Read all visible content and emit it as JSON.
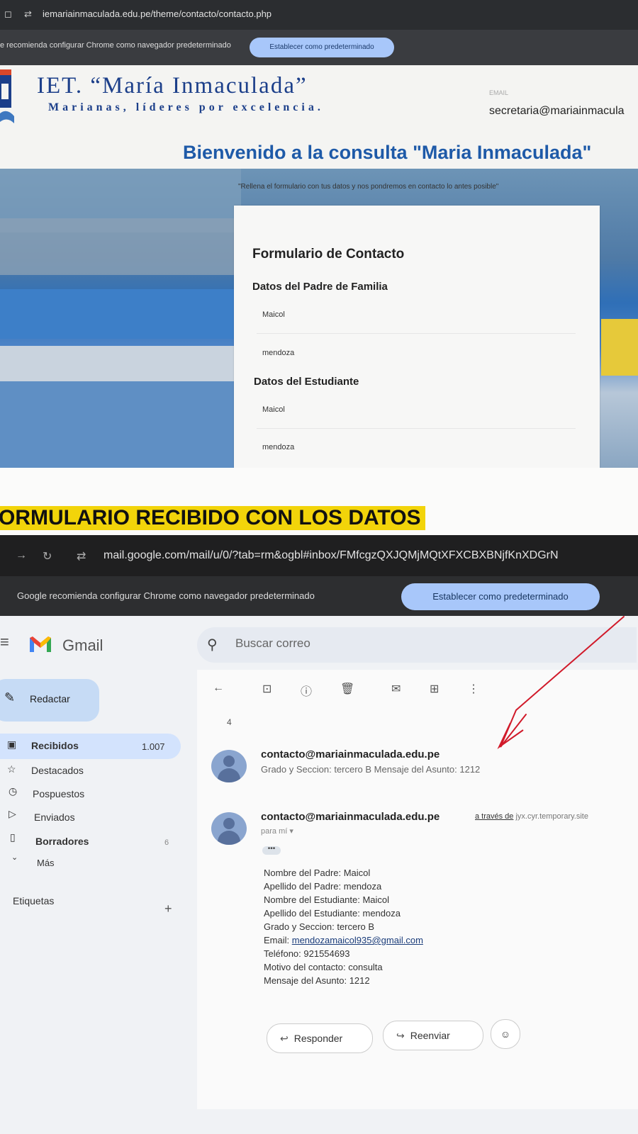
{
  "top_browser": {
    "url": "iemariainmaculada.edu.pe/theme/contacto/contacto.php",
    "banner_message": "e recomienda configurar Chrome como navegador predeterminado",
    "banner_button": "Establecer como predeterminado"
  },
  "school": {
    "name": "IET. “María Inmaculada”",
    "motto": "Marianas, líderes por excelencia.",
    "email_label": "EMAIL",
    "email_value": "secretaria@mariainmacula"
  },
  "contact_page": {
    "welcome": "Bienvenido a la consulta \"Maria Inmaculada\"",
    "subtitle": "\"Rellena el formulario con tus datos y nos pondremos en contacto lo antes posible\"",
    "form_title": "Formulario de Contacto",
    "parent_section": "Datos del Padre de Familia",
    "parent_name": "Maicol",
    "parent_lastname": "mendoza",
    "student_section": "Datos del Estudiante",
    "student_name": "Maicol",
    "student_lastname": "mendoza"
  },
  "separator_heading": "ORMULARIO RECIBIDO CON LOS DATOS",
  "gmail_browser": {
    "url": "mail.google.com/mail/u/0/?tab=rm&ogbl#inbox/FMfcgzQXJQMjMQtXFXCBXBNjfKnXDGrN",
    "banner_message": "Google recomienda configurar Chrome como navegador predeterminado",
    "banner_button": "Establecer como predeterminado"
  },
  "gmail": {
    "brand": "Gmail",
    "search_placeholder": "Buscar correo",
    "compose": "Redactar",
    "sidebar": [
      {
        "label": "Recibidos",
        "count": "1.007",
        "icon": "inbox-icon"
      },
      {
        "label": "Destacados",
        "count": "",
        "icon": "star-icon"
      },
      {
        "label": "Pospuestos",
        "count": "",
        "icon": "clock-icon"
      },
      {
        "label": "Enviados",
        "count": "",
        "icon": "send-icon"
      },
      {
        "label": "Borradores",
        "count": "6",
        "icon": "draft-icon"
      },
      {
        "label": "Más",
        "count": "",
        "icon": "chevron-down-icon"
      }
    ],
    "labels_heading": "Etiquetas",
    "thread_count": "4",
    "message1": {
      "from": "contacto@mariainmaculada.edu.pe",
      "snippet": "Grado y Seccion: tercero  B Mensaje del Asunto: 1212"
    },
    "message2": {
      "from": "contacto@mariainmaculada.edu.pe",
      "via_prefix": "a través de",
      "via_host": "jyx.cyr.temporary.site",
      "to": "para mí",
      "ellipsis": "•••",
      "body": [
        "Nombre del Padre: Maicol",
        "Apellido del Padre: mendoza",
        "Nombre del Estudiante: Maicol",
        "Apellido del Estudiante: mendoza",
        "Grado y Seccion: tercero  B",
        "Email: ",
        "Teléfono: 921554693",
        "Motivo del contacto: consulta",
        "Mensaje del Asunto: 1212"
      ],
      "body_email": "mendozamaicol935@gmail.com"
    },
    "reply": "Responder",
    "forward": "Reenviar"
  },
  "colors": {
    "school_blue": "#1c3f8a",
    "welcome_blue": "#1e5aa8",
    "highlight_yellow": "#f2d40a",
    "button_blue": "#a8c7fa",
    "annotation_red": "#d11a2a"
  }
}
